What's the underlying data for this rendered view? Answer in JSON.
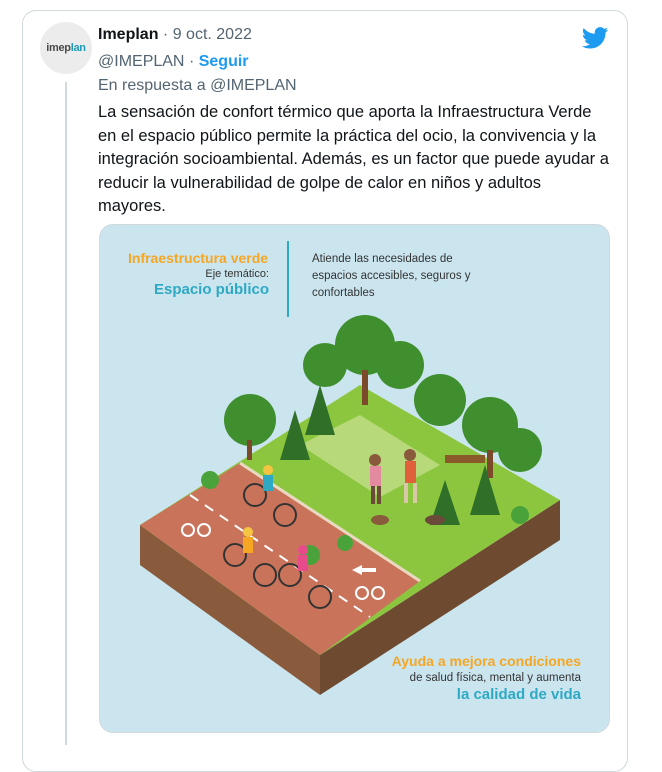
{
  "avatar": {
    "text_main": "imep",
    "text_accent": "lan"
  },
  "tweet": {
    "author_name": "Imeplan",
    "date_separator": "·",
    "date": "9 oct. 2022",
    "handle": "@IMEPLAN",
    "follow_separator": "·",
    "follow_label": "Seguir",
    "reply_to": "En respuesta a @IMEPLAN",
    "text": "La sensación de confort térmico que aporta la Infraestructura Verde en el espacio público permite la práctica del ocio, la convivencia y la integración socioambiental. Además, es un factor que puede ayudar a reducir la vulnerabilidad de golpe de calor en niños y adultos mayores."
  },
  "infographic": {
    "title": "Infraestructura verde",
    "subtitle": "Eje temático:",
    "topic": "Espacio público",
    "description": "Atiende las necesidades de espacios accesibles, seguros y confortables",
    "bottom_line1": "Ayuda a mejora condiciones",
    "bottom_line2": "de salud física, mental y aumenta",
    "bottom_line3": "la calidad de vida"
  },
  "colors": {
    "twitter_blue": "#1d9bf0",
    "orange": "#f5a623",
    "teal": "#2ea9c4",
    "media_bg": "#cbe5ef"
  },
  "icons": [
    "twitter-bird-icon"
  ]
}
